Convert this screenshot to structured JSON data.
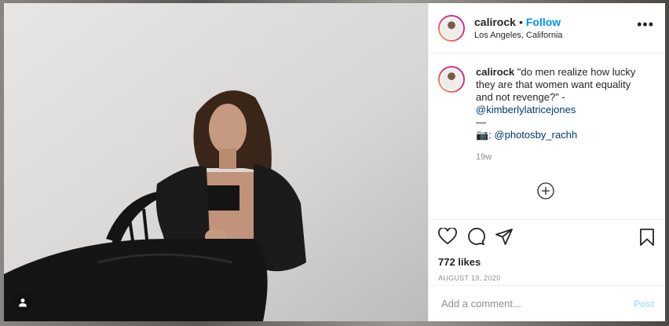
{
  "post": {
    "username": "calirock",
    "follow_label": "Follow",
    "separator": "•",
    "location": "Los Angeles, California",
    "more_label": "•••"
  },
  "caption": {
    "username": "calirock",
    "line1": "\"do men realize how lucky they are that women want equality and not revenge?\" -",
    "mention": "@kimberlylatricejones",
    "divider": "—",
    "camera": "📷",
    "colon": ": ",
    "photo_mention": "@photosby_rachh",
    "time": "19w"
  },
  "actions": {
    "likes": "772 likes",
    "date": "AUGUST 19, 2020"
  },
  "comment": {
    "placeholder": "Add a comment...",
    "post_label": "Post"
  },
  "colors": {
    "accent": "#0095f6",
    "post_disabled": "#b2dffc",
    "text": "#262626",
    "muted": "#8e8e8e"
  }
}
